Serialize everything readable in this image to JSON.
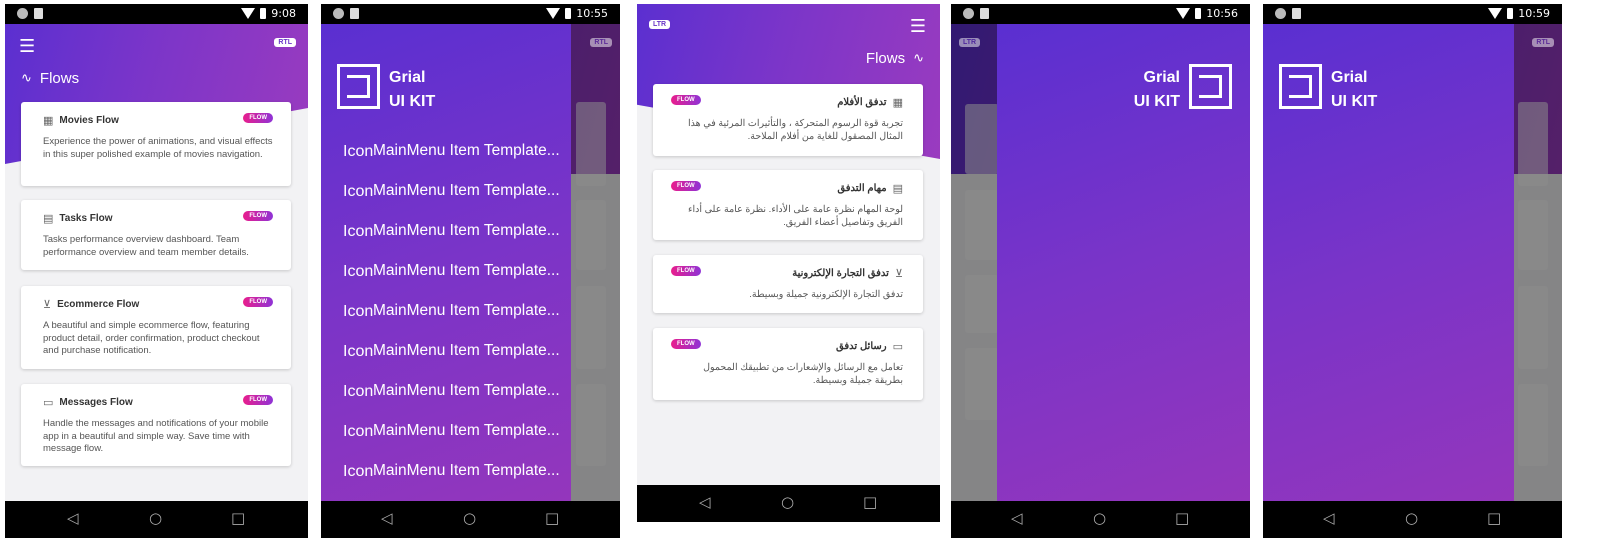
{
  "phone1": {
    "time": "9:08",
    "rtl_pill": "RTL",
    "title": "Flows",
    "cards": [
      {
        "title": "Movies Flow",
        "badge": "FLOW",
        "desc": "Experience the power of animations, and visual effects in this super polished example of movies navigation."
      },
      {
        "title": "Tasks Flow",
        "badge": "FLOW",
        "desc": "Tasks performance overview dashboard. Team performance overview and team member details."
      },
      {
        "title": "Ecommerce Flow",
        "badge": "FLOW",
        "desc": "A beautiful and simple ecommerce flow, featuring product detail, order confirmation, product checkout and purchase notification."
      },
      {
        "title": "Messages Flow",
        "badge": "FLOW",
        "desc": "Handle the messages and notifications of your mobile app in a beautiful and simple way. Save time with message flow."
      }
    ]
  },
  "phone2": {
    "time": "10:55",
    "rtl_pill": "RTL",
    "brand_line1": "Grial",
    "brand_line2": "UI KIT",
    "menu_icon": "Icon",
    "menu_item": "MainMenu Item Template...",
    "menu_count": 9
  },
  "phone3": {
    "ltr_pill": "LTR",
    "title": "Flows",
    "cards": [
      {
        "title": "تدفق الأفلام",
        "badge": "FLOW",
        "desc": "تجربة قوة الرسوم المتحركة ، والتأثيرات المرئية في هذا المثال المصقول للغاية من أفلام الملاحة."
      },
      {
        "title": "مهام التدفق",
        "badge": "FLOW",
        "desc": "لوحة المهام نظرة عامة على الأداء. نظرة عامة على أداء الفريق وتفاصيل أعضاء الفريق."
      },
      {
        "title": "تدفق التجارة الإلكترونية",
        "badge": "FLOW",
        "desc": "تدفق التجارة الإلكترونية جميلة وبسيطة."
      },
      {
        "title": "رسائل تدفق",
        "badge": "FLOW",
        "desc": "تعامل مع الرسائل والإشعارات من تطبيقك المحمول بطريقة جميلة وبسيطة."
      }
    ]
  },
  "phone4": {
    "time": "10:56",
    "ltr_pill": "LTR",
    "brand_line1": "Grial",
    "brand_line2": "UI KIT"
  },
  "phone5": {
    "time": "10:59",
    "rtl_pill": "RTL",
    "brand_line1": "Grial",
    "brand_line2": "UI KIT"
  },
  "nav": {
    "back": "◁",
    "home": "○",
    "recent": "□"
  },
  "colors": {
    "accent": "#7a34c8",
    "badge_start": "#e91e8c",
    "badge_end": "#8f33d6"
  }
}
